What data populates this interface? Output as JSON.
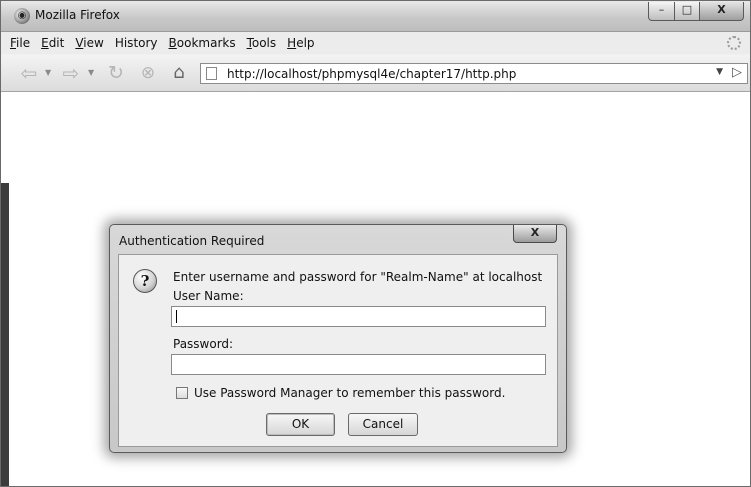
{
  "window": {
    "title": "Mozilla Firefox",
    "controls": {
      "minimize": "–",
      "maximize": "□",
      "close": "X"
    }
  },
  "menubar": {
    "items": [
      {
        "label": "File",
        "mnemonic": "F",
        "rest": "ile"
      },
      {
        "label": "Edit",
        "mnemonic": "E",
        "rest": "dit"
      },
      {
        "label": "View",
        "mnemonic": "V",
        "rest": "iew"
      },
      {
        "label": "History",
        "mnemonic": "",
        "rest": "History"
      },
      {
        "label": "Bookmarks",
        "mnemonic": "B",
        "rest": "ookmarks"
      },
      {
        "label": "Tools",
        "mnemonic": "T",
        "rest": "ools"
      },
      {
        "label": "Help",
        "mnemonic": "H",
        "rest": "elp"
      }
    ]
  },
  "navbar": {
    "icons": [
      "back-arrow-icon",
      "forward-arrow-icon",
      "reload-icon",
      "stop-icon",
      "home-icon"
    ],
    "url": "http://localhost/phpmysql4e/chapter17/http.php"
  },
  "dialog": {
    "title": "Authentication Required",
    "close_label": "X",
    "icon": "question-icon",
    "prompt": "Enter username and password for \"Realm-Name\" at localhost",
    "username_label": "User Name:",
    "username_value": "",
    "password_label": "Password:",
    "password_value": "",
    "remember_label": "Use Password Manager to remember this password.",
    "remember_checked": false,
    "ok_label": "OK",
    "cancel_label": "Cancel"
  }
}
